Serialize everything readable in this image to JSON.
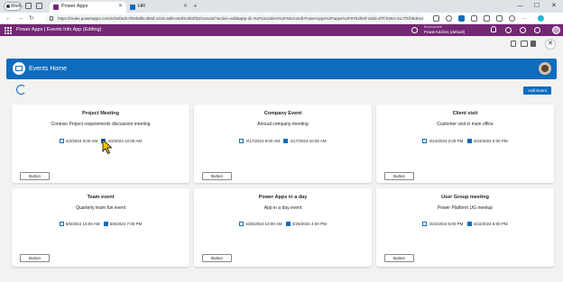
{
  "browser": {
    "profile_label": "Work",
    "tabs": [
      {
        "label": "Power Apps",
        "active": true
      },
      {
        "label": "HR",
        "active": false
      }
    ],
    "url": "https://make.powerapps.com/e/Default-0f3eb6f6-d93d-42c8-a6f5-e63f4c6b2f33/canvas/?action=edit&app-id=%2Fproviders%2FMicrosoft.PowerApps%2Fapps%2F97b4fe0f-c6d3-4f7f-b084-41c7f1f0bde1e"
  },
  "powerapps_header": {
    "title": "Power Apps  |  Events Info App (Editing)",
    "environment_label": "Environment",
    "environment_name": "PowerAddicts (default)"
  },
  "app": {
    "title": "Events Home",
    "add_event_label": "Add Event",
    "events": [
      {
        "title": "Project Meeting",
        "description": "Contoso Project requirements discussion meeting",
        "start": "4/2/2024 9:00 AM",
        "end": "4/2/2024 10:00 AM",
        "button": "Button"
      },
      {
        "title": "Company Event",
        "description": "Annual company meeting",
        "start": "4/17/2024 9:00 AM",
        "end": "4/17/2024 10:00 AM",
        "button": "Button"
      },
      {
        "title": "Client visit",
        "description": "Customer visit in main office",
        "start": "4/24/2024 2:00 PM",
        "end": "4/24/2024 6:00 PM",
        "button": "Button"
      },
      {
        "title": "Team event",
        "description": "Quarterly team fun event",
        "start": "5/6/2024 10:00 AM",
        "end": "5/6/2024 7:00 PM",
        "button": "Button"
      },
      {
        "title": "Power Apps in a day",
        "description": "App in a day event",
        "start": "4/25/2024 10:00 AM",
        "end": "4/25/2024 4:00 PM",
        "button": "Button"
      },
      {
        "title": "User Group meeting",
        "description": "Power Platform UG meetup",
        "start": "4/22/2024 5:00 PM",
        "end": "4/22/2024 6:00 PM",
        "button": "Button"
      }
    ]
  },
  "colors": {
    "powerapps_purple": "#742774",
    "app_blue": "#0f6cbd",
    "background": "#f3f2f1"
  }
}
